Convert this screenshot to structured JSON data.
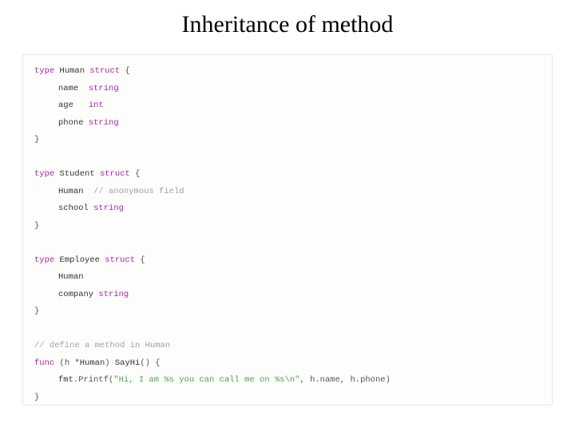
{
  "title": "Inheritance of method",
  "code": {
    "kw_type": "type",
    "kw_struct": "struct",
    "kw_func": "func",
    "brace_open": " {",
    "brace_close": "}",
    "paren_close": ")",
    "struct1": {
      "name": "Human",
      "f1": "name",
      "t1": "string",
      "f2": "age",
      "t2": "int",
      "f3": "phone",
      "t3": "string"
    },
    "struct2": {
      "name": "Student",
      "f1": "Human",
      "cmt1": "  // anonymous field",
      "f2": "school",
      "t2": "string"
    },
    "struct3": {
      "name": "Employee",
      "f1": "Human",
      "f2": "company",
      "t2": "string"
    },
    "method": {
      "cmt": "// define a method in Human",
      "recv_open": " (",
      "recv_var": "h ",
      "recv_type": "*Human",
      "name": "SayHi",
      "args": "()",
      "body_pkg": "fmt",
      "body_call": ".Printf(",
      "body_str": "\"Hi, I am %s you can call me on %s\\n\"",
      "body_rest": ", h.name, h.phone)"
    }
  }
}
